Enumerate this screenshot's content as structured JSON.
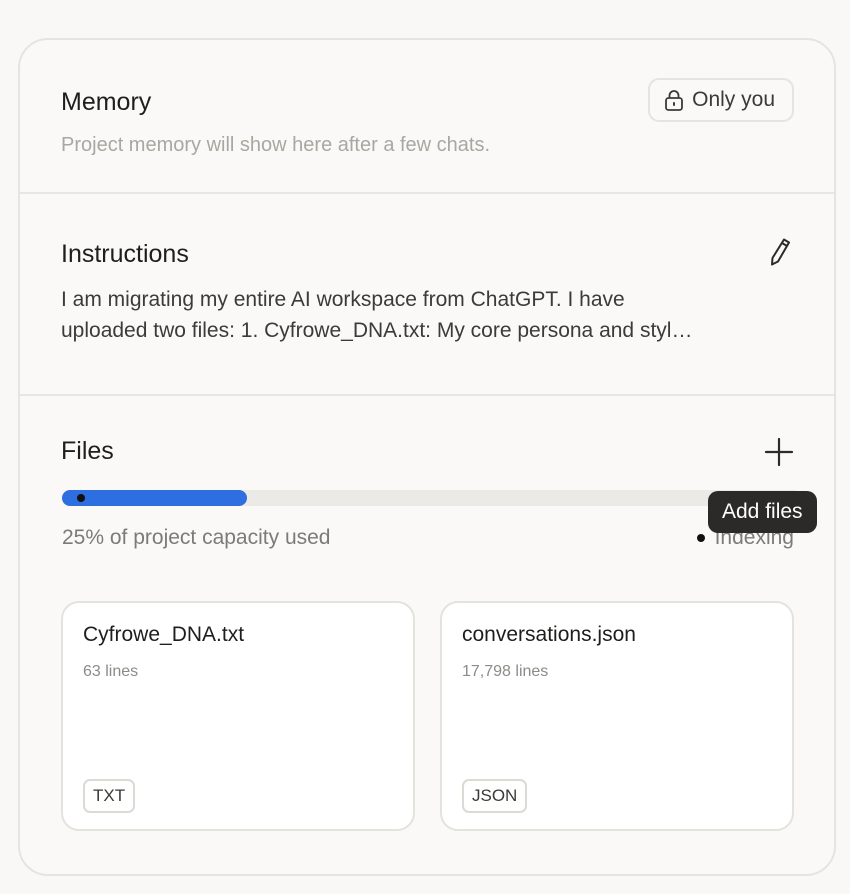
{
  "memory": {
    "title": "Memory",
    "subtitle": "Project memory will show here after a few chats.",
    "privacy_label": "Only you",
    "privacy_icon": "lock-icon"
  },
  "instructions": {
    "title": "Instructions",
    "edit_icon": "pencil-icon",
    "line1": "I am migrating my entire AI workspace from ChatGPT. I have",
    "line2": "uploaded two files: 1. Cyfrowe_DNA.txt: My core persona and styl…"
  },
  "files": {
    "title": "Files",
    "add_icon": "plus-icon",
    "add_tooltip": "Add files",
    "capacity_fraction": 0.25,
    "capacity_text": "25% of project capacity used",
    "status_text": "Indexing",
    "items": [
      {
        "name": "Cyfrowe_DNA.txt",
        "lines": "63 lines",
        "type": "TXT"
      },
      {
        "name": "conversations.json",
        "lines": "17,798 lines",
        "type": "JSON"
      }
    ]
  },
  "colors": {
    "progress": "#2d6ee0",
    "tooltip_bg": "#2b2a28"
  }
}
